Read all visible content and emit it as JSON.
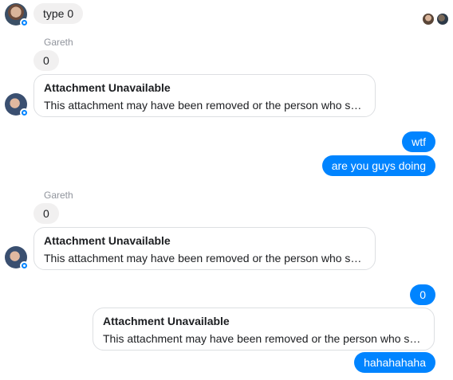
{
  "thread": {
    "first_message": "type 0",
    "sender_name_1": "Gareth",
    "msg_zero_1": "0",
    "attachment_1": {
      "title": "Attachment Unavailable",
      "description": "This attachment may have been removed or the person who s…"
    },
    "out_msg_1": "wtf",
    "out_msg_2": "are you guys doing",
    "sender_name_2": "Gareth",
    "msg_zero_2": "0",
    "attachment_2": {
      "title": "Attachment Unavailable",
      "description": "This attachment may have been removed or the person who s…"
    },
    "out_msg_3": "0",
    "attachment_3": {
      "title": "Attachment Unavailable",
      "description": "This attachment may have been removed or the person who s…"
    },
    "out_msg_4": "hahahahaha"
  },
  "colors": {
    "outgoing_bubble": "#0084ff",
    "incoming_bubble": "#f1f0f0",
    "sender_name": "#90949c"
  },
  "icons": {
    "avatar_badge": "messenger-badge-icon"
  }
}
